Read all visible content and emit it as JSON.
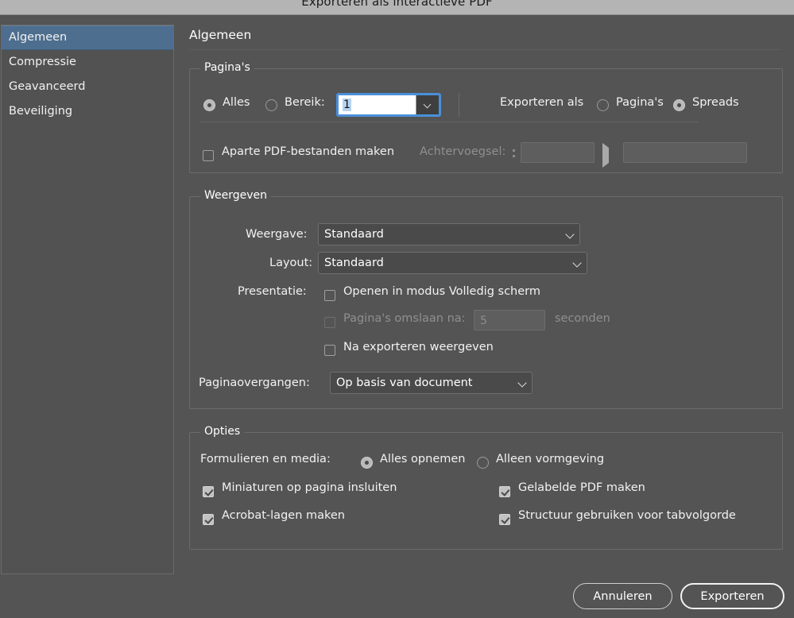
{
  "window": {
    "title": "Exporteren als interactieve PDF"
  },
  "sidebar": {
    "items": [
      {
        "label": "Algemeen"
      },
      {
        "label": "Compressie"
      },
      {
        "label": "Geavanceerd"
      },
      {
        "label": "Beveiliging"
      }
    ],
    "selected_index": 0
  },
  "main": {
    "panel_title": "Algemeen",
    "pages_group": {
      "legend": "Pagina's",
      "all_radio_label": "Alles",
      "range_radio_label": "Bereik:",
      "range_value": "1",
      "export_as_label": "Exporteren als",
      "export_pages_label": "Pagina's",
      "export_spreads_label": "Spreads",
      "separate_files_label": "Aparte PDF-bestanden maken",
      "suffix_label": "Achtervoegsel:",
      "suffix_value": "",
      "suffix_value_2": ""
    },
    "view_group": {
      "legend": "Weergeven",
      "view_label": "Weergave:",
      "view_value": "Standaard",
      "layout_label": "Layout:",
      "layout_value": "Standaard",
      "presentation_label": "Presentatie:",
      "fullscreen_label": "Openen in modus Volledig scherm",
      "flip_pages_label": "Pagina's omslaan na:",
      "flip_pages_value": "5",
      "seconds_label": "seconden",
      "view_after_export_label": "Na exporteren weergeven",
      "page_transitions_label": "Paginaovergangen:",
      "page_transitions_value": "Op basis van document"
    },
    "options_group": {
      "legend": "Opties",
      "forms_media_label": "Formulieren en media:",
      "include_all_label": "Alles opnemen",
      "appearance_only_label": "Alleen vormgeving",
      "embed_thumbnails_label": "Miniaturen op pagina insluiten",
      "tagged_pdf_label": "Gelabelde PDF maken",
      "acrobat_layers_label": "Acrobat-lagen maken",
      "structure_taborder_label": "Structuur gebruiken voor tabvolgorde"
    }
  },
  "footer": {
    "cancel_label": "Annuleren",
    "export_label": "Exporteren"
  },
  "colors": {
    "window_bg": "#545454",
    "titlebar_bg": "#b4b4b4",
    "sidebar_selection": "#4d6e8e",
    "focus_border": "#4a90d9",
    "text": "#f2f2f2",
    "disabled_text": "#8f8f8f"
  }
}
